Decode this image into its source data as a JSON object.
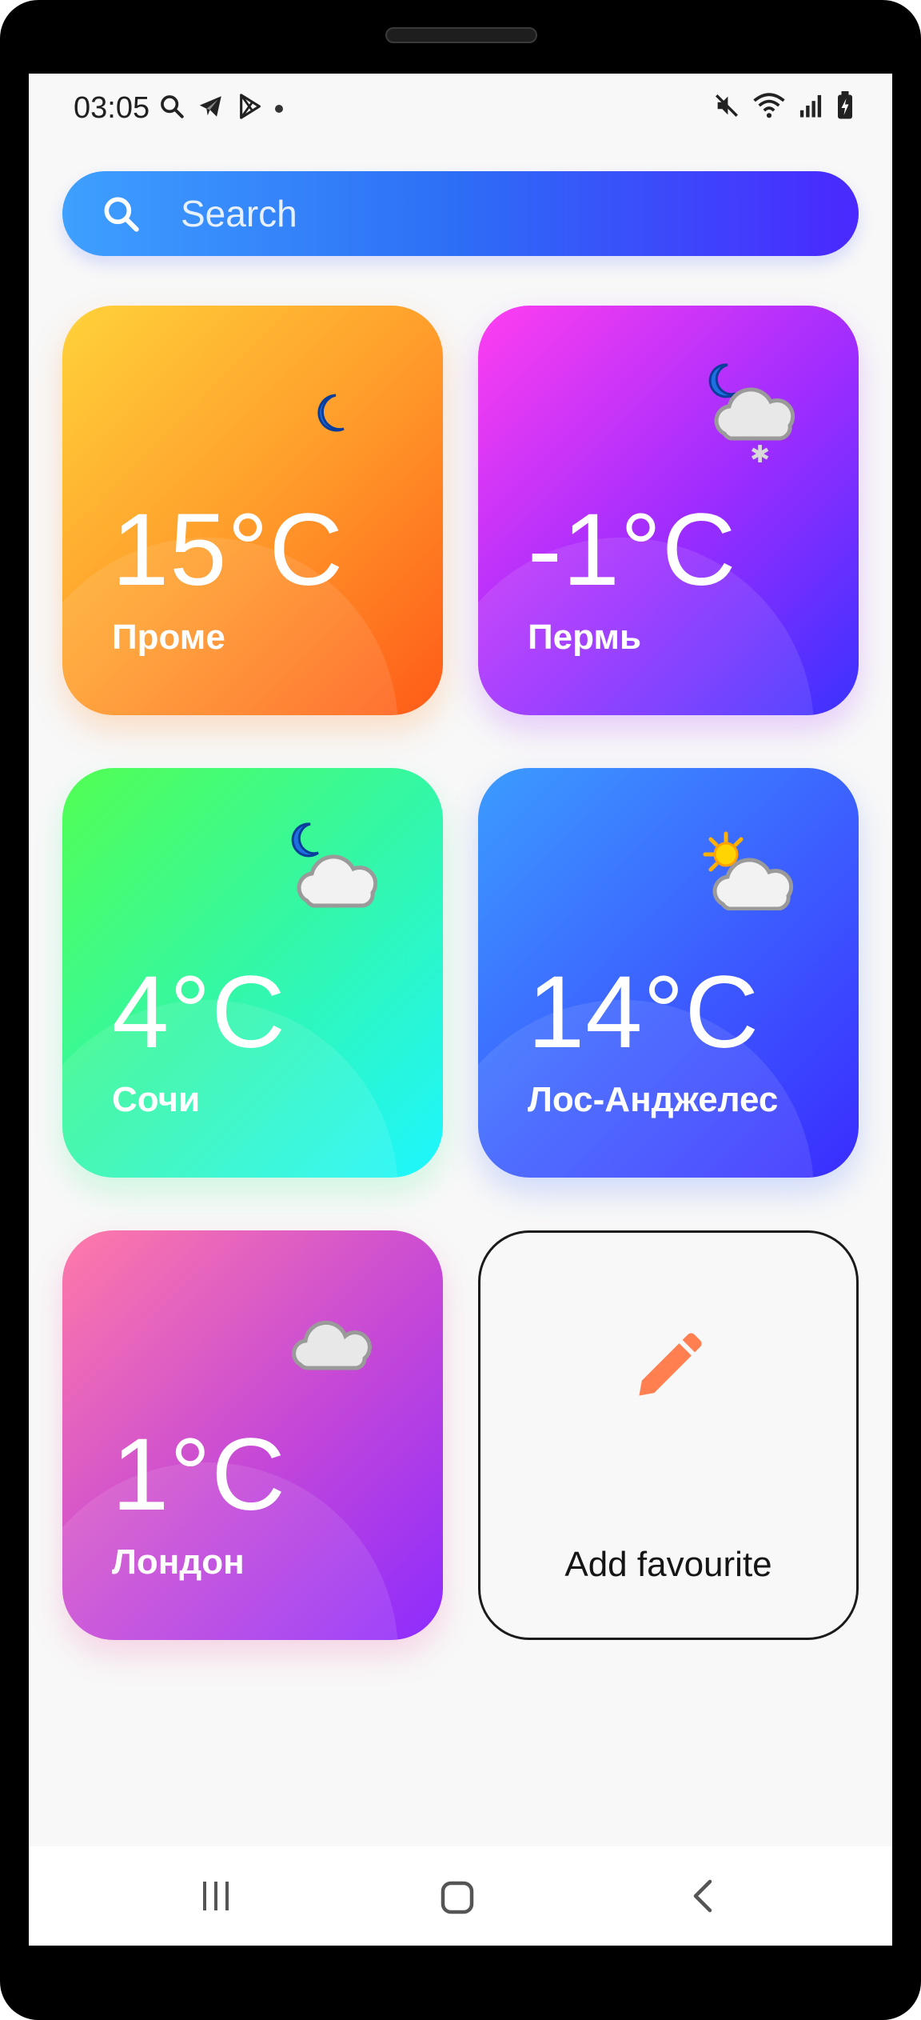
{
  "status_bar": {
    "time": "03:05",
    "left_icons": [
      "search-icon",
      "telegram-icon",
      "play-store-icon",
      "notification-dot"
    ],
    "right_icons": [
      "mute-icon",
      "wifi-icon",
      "signal-icon",
      "battery-charging-icon"
    ]
  },
  "search": {
    "placeholder": "Search",
    "icon": "search-icon",
    "gradient": [
      "#3ea0ff",
      "#4a28ff"
    ]
  },
  "cities": [
    {
      "temp": "15°C",
      "city": "Проме",
      "icon": "moon-icon",
      "gradient": [
        "#ffd23a",
        "#ff5b18"
      ]
    },
    {
      "temp": "-1°C",
      "city": "Пермь",
      "icon": "moon-cloud-snow-icon",
      "gradient": [
        "#ff3ef0",
        "#3a32ff"
      ]
    },
    {
      "temp": "4°C",
      "city": "Сочи",
      "icon": "moon-cloud-icon",
      "gradient": [
        "#52ff52",
        "#1ef6ff"
      ]
    },
    {
      "temp": "14°C",
      "city": "Лос-Анджелес",
      "icon": "sun-cloud-icon",
      "gradient": [
        "#3c9cff",
        "#3a2cff"
      ]
    },
    {
      "temp": "1°C",
      "city": "Лондон",
      "icon": "cloud-icon",
      "gradient": [
        "#ff7aa8",
        "#8d2cff"
      ]
    }
  ],
  "add_card": {
    "label": "Add favourite",
    "icon": "pencil-icon",
    "icon_color": "#ff7f50"
  },
  "nav_bar": {
    "buttons": [
      "recent-apps-icon",
      "home-icon",
      "back-icon"
    ]
  }
}
